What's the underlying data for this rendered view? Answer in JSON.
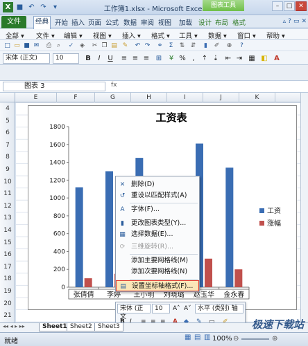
{
  "window": {
    "title": "工作簿1.xlsx - Microsoft Excel",
    "context_tab": "图表工具"
  },
  "ribbon_tabs": [
    "文件",
    "经典",
    "开始",
    "插入",
    "页面",
    "公式",
    "数据",
    "审阅",
    "视图",
    "加载",
    "设计",
    "布局",
    "格式"
  ],
  "menu_items": [
    "全部 ▾",
    "文件 ▾",
    "编辑 ▾",
    "视图 ▾",
    "插入 ▾",
    "格式 ▾",
    "工具 ▾",
    "数据 ▾",
    "窗口 ▾",
    "帮助 ▾"
  ],
  "toolbar": {
    "font_name": "宋体 (正文)",
    "font_size": "10",
    "bold": "B",
    "italic": "I",
    "underline": "U"
  },
  "name_box": {
    "value": "图表 3"
  },
  "columns": [
    "E",
    "F",
    "G",
    "H",
    "I",
    "J",
    "K"
  ],
  "rows": [
    "4",
    "5",
    "6",
    "7",
    "8",
    "9",
    "10",
    "11",
    "12",
    "13",
    "14",
    "15",
    "16",
    "17",
    "18",
    "19",
    "20",
    "21"
  ],
  "chart_data": {
    "type": "bar",
    "title": "工资表",
    "categories": [
      "张倩倩",
      "李婷",
      "王小明",
      "刘晓璐",
      "赵玉华",
      "金永春"
    ],
    "series": [
      {
        "name": "工资",
        "values": [
          1120,
          1300,
          1450,
          1020,
          1610,
          1340
        ],
        "color": "#3a6db3"
      },
      {
        "name": "涨幅",
        "values": [
          100,
          150,
          180,
          80,
          320,
          200
        ],
        "color": "#c0504d"
      }
    ],
    "ylim": [
      0,
      1800
    ],
    "yticks": [
      0,
      200,
      400,
      600,
      800,
      1000,
      1200,
      1400,
      1600,
      1800
    ],
    "legend": "right",
    "grid": false
  },
  "context_menu": {
    "items": [
      {
        "label": "删除(D)",
        "icon": "delete-icon",
        "disabled": false
      },
      {
        "label": "重设以匹配样式(A)",
        "icon": "reset-style-icon",
        "disabled": false
      },
      {
        "label": "字体(F)...",
        "icon": "font-icon",
        "glyph": "A",
        "disabled": false
      },
      {
        "label": "更改图表类型(Y)...",
        "icon": "chart-type-icon",
        "disabled": false
      },
      {
        "label": "选择数据(E)...",
        "icon": "select-data-icon",
        "disabled": false
      },
      {
        "label": "三维旋转(R)...",
        "icon": "rotate-3d-icon",
        "disabled": true
      },
      {
        "label": "添加主要网格线(M)",
        "icon": "",
        "disabled": false
      },
      {
        "label": "添加次要网格线(N)",
        "icon": "",
        "disabled": false
      },
      {
        "label": "设置坐标轴格式(F)...",
        "icon": "format-axis-icon",
        "disabled": false,
        "highlighted": true
      }
    ]
  },
  "mini_toolbar": {
    "font_name": "宋体 (正文",
    "font_size": "10",
    "grow_font": "A˄",
    "shrink_font": "A˅",
    "axis_select": "水平 (类别) 轴",
    "bold": "B",
    "italic": "I"
  },
  "sheets": [
    "Sheet1",
    "Sheet2",
    "Sheet3"
  ],
  "status": {
    "ready": "就绪",
    "zoom": "100%"
  },
  "watermark": "极速下载站"
}
